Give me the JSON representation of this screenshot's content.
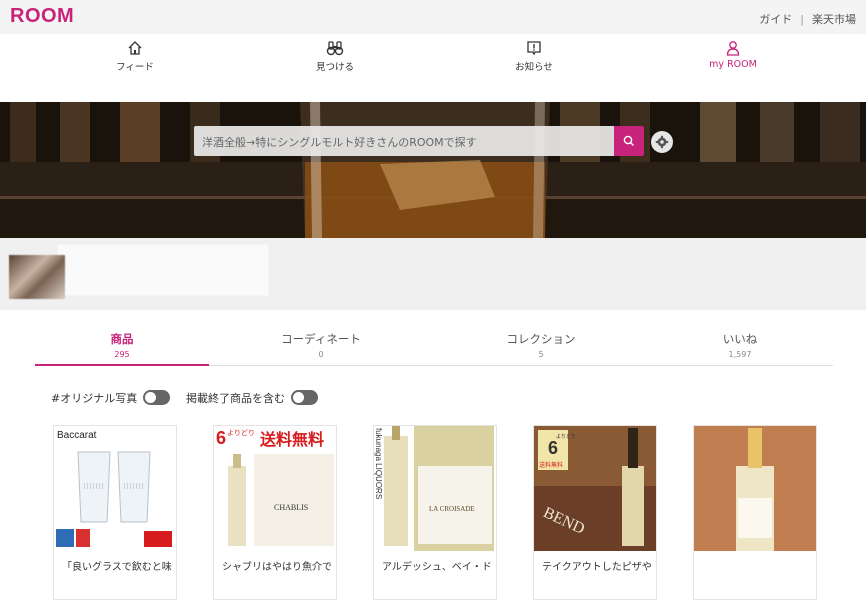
{
  "header": {
    "logo": "ROOM",
    "links": [
      "ガイド",
      "楽天市場"
    ],
    "separator": "|"
  },
  "nav": [
    {
      "label": "フィード",
      "icon": "home-icon"
    },
    {
      "label": "見つける",
      "icon": "binoculars-icon"
    },
    {
      "label": "お知らせ",
      "icon": "notification-icon"
    },
    {
      "label": "my ROOM",
      "icon": "user-icon",
      "active": true
    }
  ],
  "search": {
    "placeholder": "洋酒全般→特にシングルモルト好きさんのROOMで探す",
    "button_icon": "search-icon",
    "settings_icon": "gear-icon"
  },
  "tabs": [
    {
      "label": "商品",
      "count": "295",
      "active": true
    },
    {
      "label": "コーディネート",
      "count": "0"
    },
    {
      "label": "コレクション",
      "count": "5"
    },
    {
      "label": "いいね",
      "count": "1,597"
    }
  ],
  "filters": [
    {
      "label": "#オリジナル写真",
      "on": false
    },
    {
      "label": "掲載終了商品を含む",
      "on": false
    }
  ],
  "products": [
    {
      "caption": "「良いグラスで飲むと味",
      "image_text": "Baccarat"
    },
    {
      "caption": "シャブリはやはり魚介で",
      "image_text": "送料無料",
      "badge": "6本以上",
      "badge_small": "よりどり",
      "label_text": "CHABLIS"
    },
    {
      "caption": "アルデッシュ、ベイ・ド",
      "image_text": "LA CROISADE",
      "side_text": "fukunaga LIQUORS"
    },
    {
      "caption": "テイクアウトしたピザや",
      "badge": "6本以上",
      "badge_small": "よりどり",
      "badge_sub": "送料無料",
      "label_text": "BEND"
    },
    {
      "caption": ""
    }
  ],
  "colors": {
    "brand": "#c7237b",
    "topbar_bg": "#f4f4f4",
    "profile_bg": "#f0f0f0"
  }
}
